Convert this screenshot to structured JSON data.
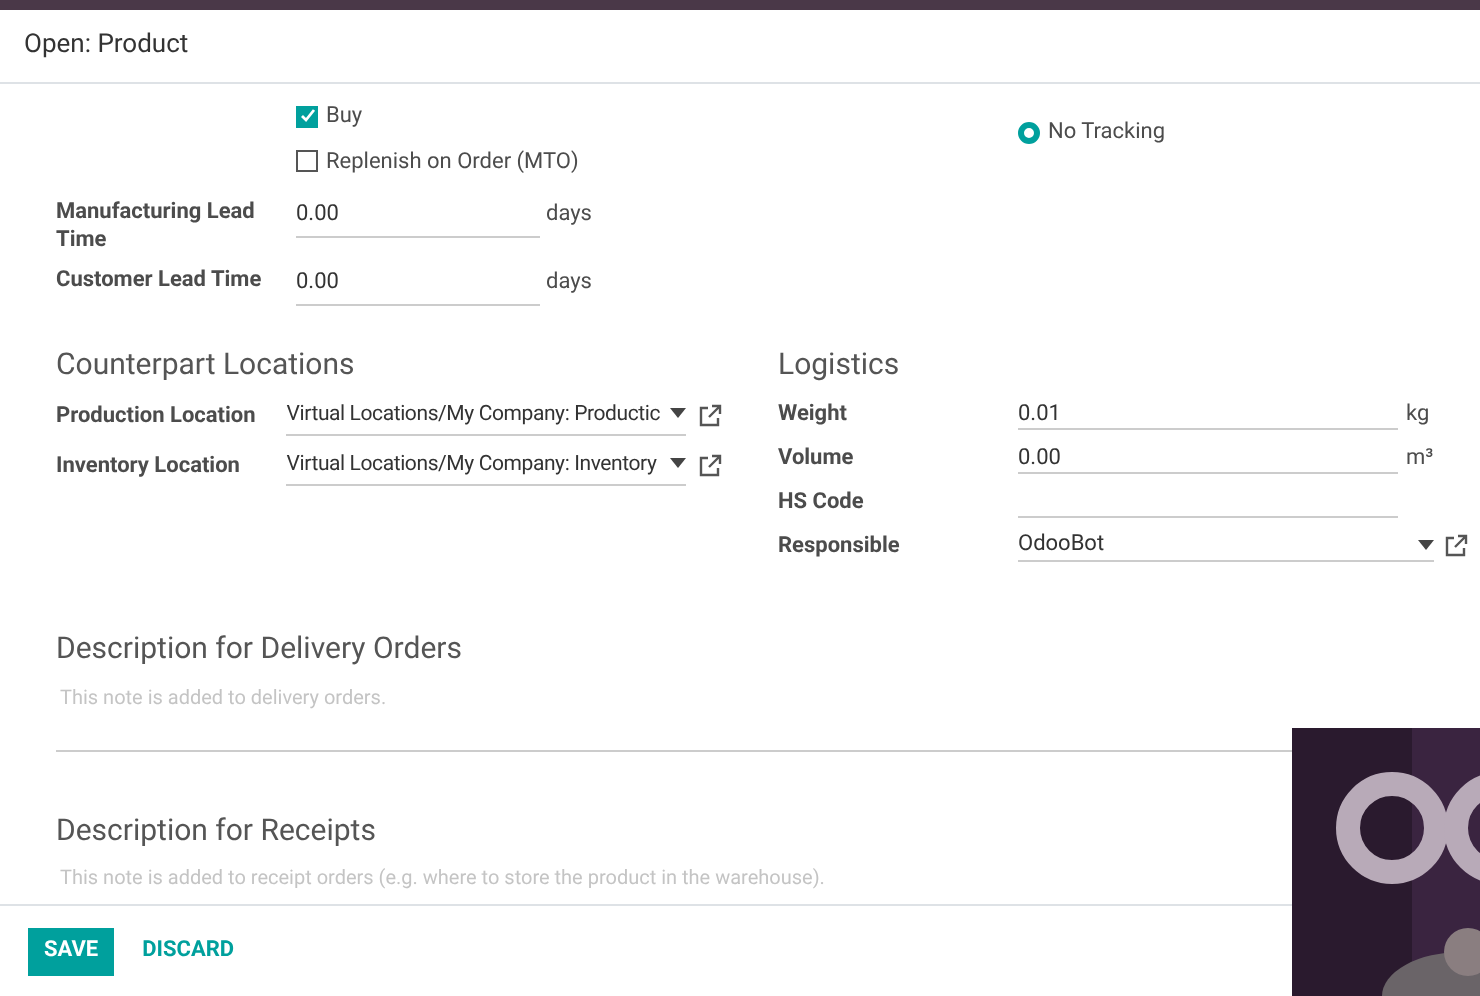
{
  "dialog": {
    "title": "Open: Product"
  },
  "routes": [
    {
      "label": "Buy",
      "checked": true
    },
    {
      "label": "Replenish on Order (MTO)",
      "checked": false
    }
  ],
  "tracking": [
    {
      "label": "No Tracking",
      "selected": true
    }
  ],
  "lead_times": [
    {
      "label": "Manufacturing Lead Time",
      "value": "0.00",
      "unit": "days"
    },
    {
      "label": "Customer Lead Time",
      "value": "0.00",
      "unit": "days"
    }
  ],
  "counterpart_locations": {
    "title": "Counterpart Locations",
    "fields": [
      {
        "label": "Production Location",
        "value": "Virtual Locations/My Company: Productic"
      },
      {
        "label": "Inventory Location",
        "value": "Virtual Locations/My Company: Inventory"
      }
    ]
  },
  "logistics": {
    "title": "Logistics",
    "fields": [
      {
        "kind": "input",
        "label": "Weight",
        "value": "0.01",
        "unit": "kg"
      },
      {
        "kind": "input",
        "label": "Volume",
        "value": "0.00",
        "unit": "m³"
      },
      {
        "kind": "input",
        "label": "HS Code"
      },
      {
        "kind": "select",
        "label": "Responsible",
        "value": "OdooBot"
      }
    ]
  },
  "descriptions": [
    {
      "title": "Description for Delivery Orders",
      "placeholder": "This note is added to delivery orders."
    },
    {
      "title": "Description for Receipts",
      "placeholder": "This note is added to receipt orders (e.g. where to store the product in the warehouse)."
    }
  ],
  "footer": {
    "buttons": [
      {
        "label": "SAVE",
        "kind": "primary"
      },
      {
        "label": "DISCARD",
        "kind": "link"
      }
    ]
  }
}
